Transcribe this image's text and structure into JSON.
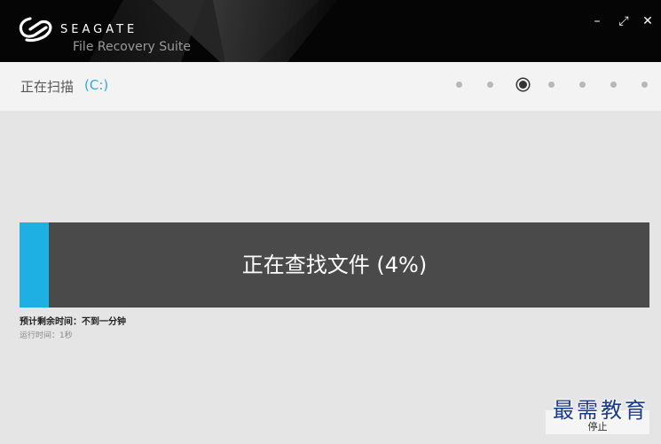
{
  "titlebar": {
    "brand": "SEAGATE",
    "product": "File Recovery Suite",
    "controls": {
      "minimize": "–",
      "maximize": "⤢",
      "close": "✕"
    }
  },
  "header": {
    "status_label": "正在扫描",
    "drive": "(C:)",
    "steps_total": 7,
    "step_active": 3
  },
  "progress": {
    "label": "正在查找文件 (4%)",
    "percent": 4
  },
  "info": {
    "eta": "预计剩余时间：不到一分钟",
    "elapsed": "运行时间：1秒"
  },
  "actions": {
    "stop_label": "停止"
  },
  "watermark": "最需教育",
  "colors": {
    "accent": "#1fb0e3",
    "progress_bg": "#4a4a4a",
    "titlebar_bg": "#050505"
  }
}
